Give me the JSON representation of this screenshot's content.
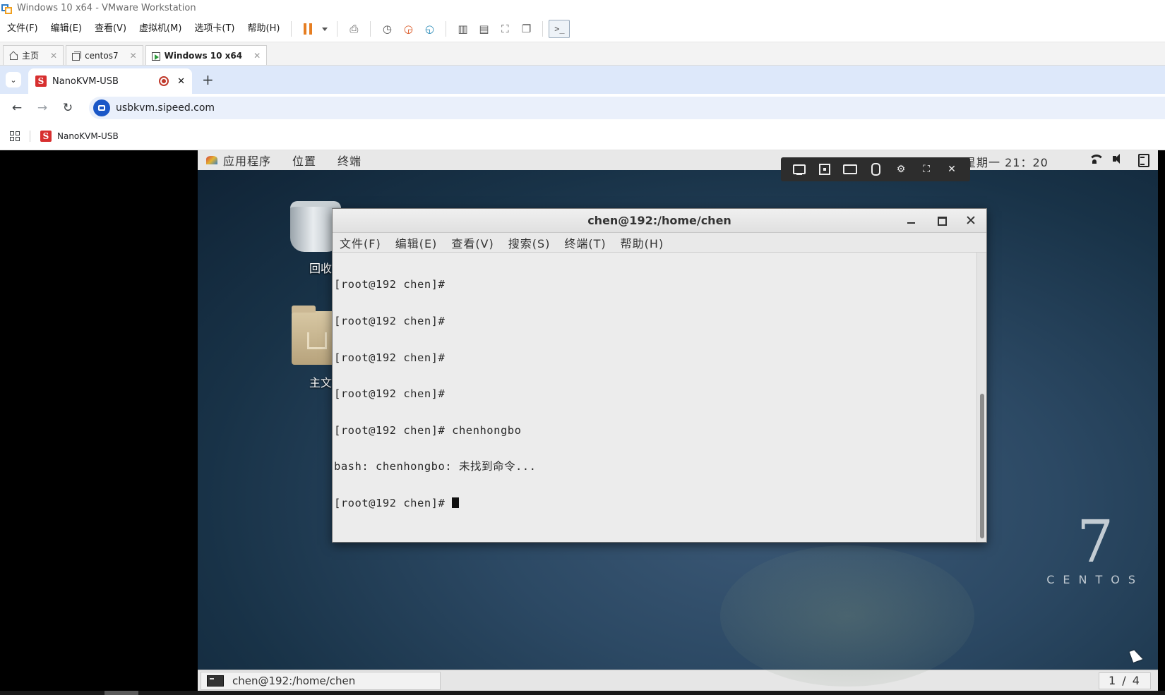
{
  "window": {
    "title": "Windows 10 x64 - VMware Workstation"
  },
  "vmware": {
    "menu": [
      "文件(F)",
      "编辑(E)",
      "查看(V)",
      "虚拟机(M)",
      "选项卡(T)",
      "帮助(H)"
    ],
    "tabs": [
      {
        "label": "主页",
        "icon": "home-icon"
      },
      {
        "label": "centos7",
        "icon": "vm-icon"
      },
      {
        "label": "Windows 10 x64",
        "icon": "vm-running-icon"
      }
    ],
    "accent": "#e67e22"
  },
  "browser": {
    "tab_title": "NanoKVM-USB",
    "address": "usbkvm.sipeed.com",
    "bookmark": "NanoKVM-USB",
    "favicon_letter": "S",
    "new_tab_symbol": "+",
    "close_symbol": "✕"
  },
  "guest": {
    "top_menu": [
      "应用程序",
      "位置",
      "终端"
    ],
    "clock": "星期一 21：20",
    "desktop_icons": [
      {
        "label": "回收站",
        "icon": "trash-icon"
      },
      {
        "label": "主文件夹",
        "icon": "home-folder-icon"
      }
    ],
    "brand_number": "7",
    "brand_text": "CENTOS",
    "taskbar_item": "chen@192:/home/chen",
    "workspace": "1 / 4"
  },
  "terminal": {
    "title": "chen@192:/home/chen",
    "menu": [
      "文件(F)",
      "编辑(E)",
      "查看(V)",
      "搜索(S)",
      "终端(T)",
      "帮助(H)"
    ],
    "lines": [
      "[root@192 chen]#",
      "[root@192 chen]#",
      "[root@192 chen]#",
      "[root@192 chen]#",
      "[root@192 chen]# chenhongbo",
      "bash: chenhongbo: 未找到命令...",
      "[root@192 chen]# "
    ]
  }
}
